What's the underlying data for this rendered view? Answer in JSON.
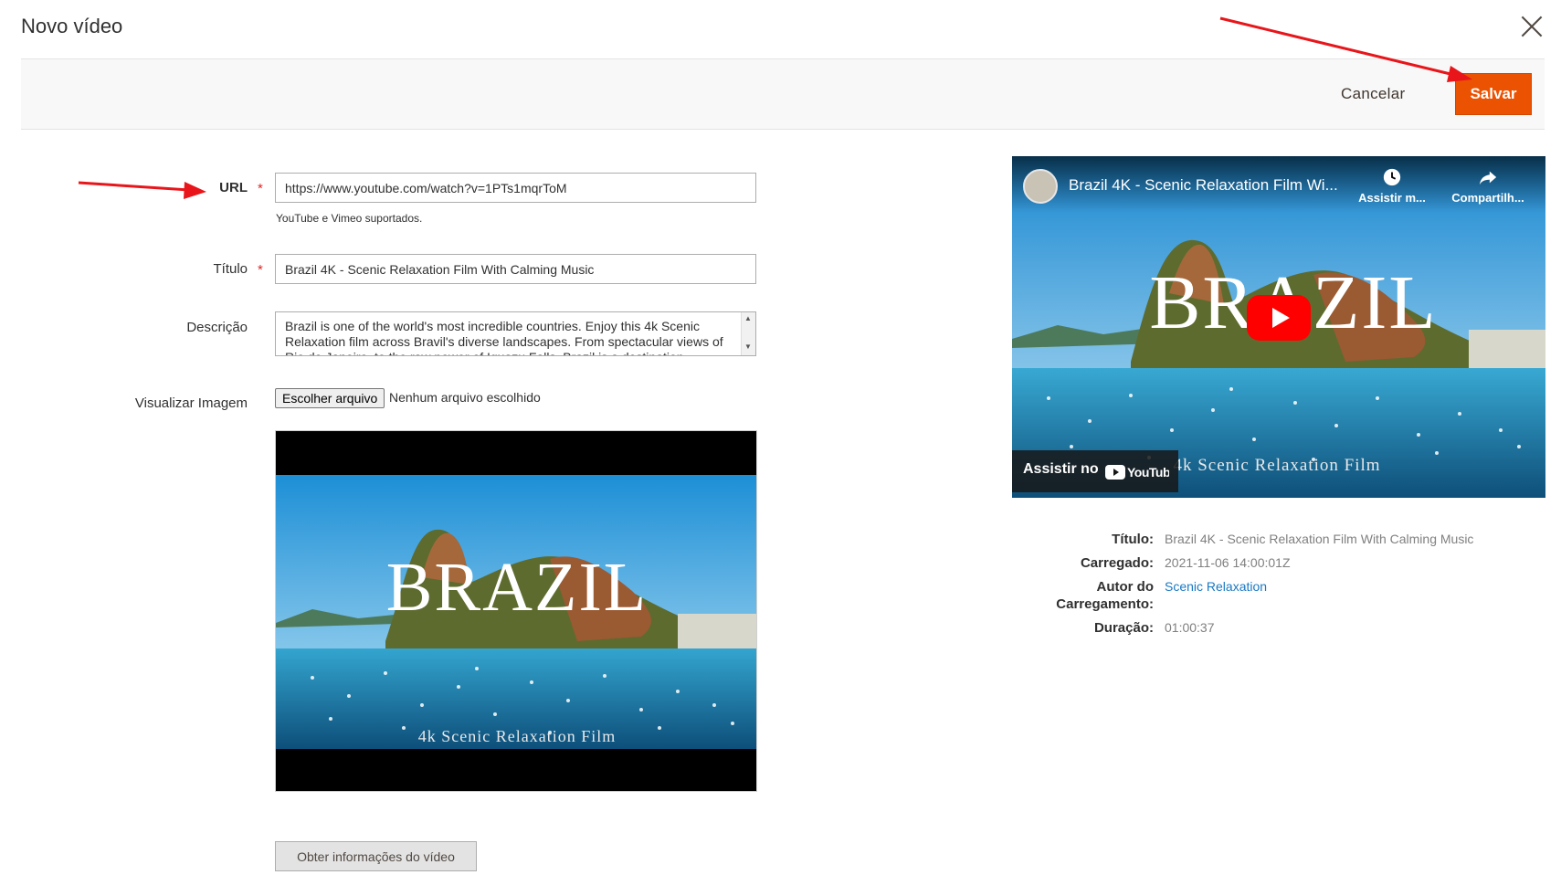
{
  "modal": {
    "title": "Novo vídeo"
  },
  "actions": {
    "cancel_label": "Cancelar",
    "save_label": "Salvar"
  },
  "form": {
    "url": {
      "label": "URL",
      "required_mark": "*",
      "value": "https://www.youtube.com/watch?v=1PTs1mqrToM",
      "hint": "YouTube e Vimeo suportados."
    },
    "title": {
      "label": "Título",
      "required_mark": "*",
      "value": "Brazil 4K - Scenic Relaxation Film With Calming Music"
    },
    "description": {
      "label": "Descrição",
      "value": "Brazil is one of the world's most incredible countries. Enjoy this 4k Scenic Relaxation film across Bravil's diverse landscapes. From spectacular views of Rio de Janeiro, to the raw power of Iguazu Falls, Brazil is a destination"
    },
    "preview_image": {
      "label": "Visualizar Imagem",
      "button_label": "Escolher arquivo",
      "status": "Nenhum arquivo escolhido"
    },
    "get_info_label": "Obter informações do vídeo"
  },
  "thumbnail": {
    "heading": "BRAZIL",
    "subheading": "4k Scenic Relaxation Film"
  },
  "player": {
    "title": "Brazil 4K - Scenic Relaxation Film Wi...",
    "watch_later": "Assistir m...",
    "share": "Compartilh...",
    "heading": "BRAZIL",
    "subheading": "4k Scenic Relaxation Film",
    "watch_on": "Assistir no",
    "youtube_logo": "YouTube"
  },
  "video_info": {
    "title_label": "Título:",
    "title_value": "Brazil 4K - Scenic Relaxation Film With Calming Music",
    "uploaded_label": "Carregado:",
    "uploaded_value": "2021-11-06 14:00:01Z",
    "author_label_1": "Autor do",
    "author_label_2": "Carregamento:",
    "author_value": "Scenic Relaxation",
    "duration_label": "Duração:",
    "duration_value": "01:00:37"
  },
  "colors": {
    "accent": "#eb5202",
    "annotation_arrow": "#e8161b",
    "link": "#1979c3",
    "required": "#e22626"
  }
}
